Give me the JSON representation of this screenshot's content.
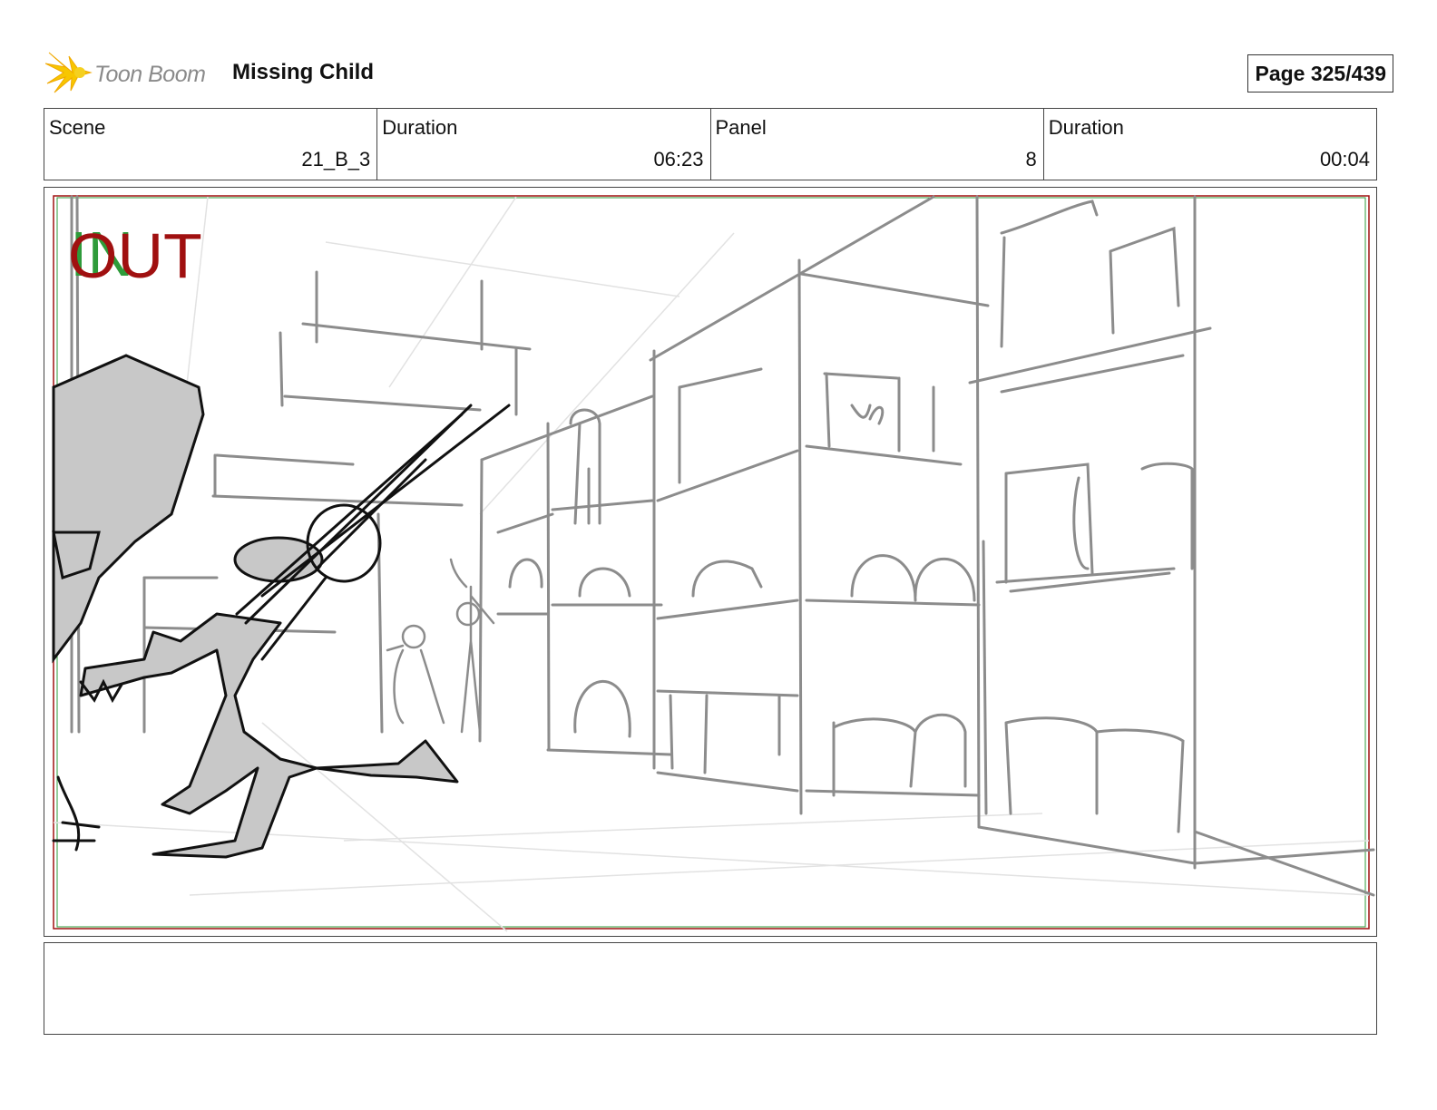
{
  "header": {
    "logo_text": "Toon Boom",
    "project_title": "Missing Child",
    "page_label": "Page 325/439"
  },
  "info": [
    {
      "label": "Scene",
      "value": "21_B_3"
    },
    {
      "label": "Duration",
      "value": "06:23"
    },
    {
      "label": "Panel",
      "value": "8"
    },
    {
      "label": "Duration",
      "value": "00:04"
    }
  ],
  "panel": {
    "in_marker": "IN",
    "out_marker": "OUT",
    "colors": {
      "in": "#2e9b3a",
      "out": "#a01010",
      "sketch": "#8c8c8c",
      "ink": "#111111",
      "fill": "#c8c8c8"
    }
  },
  "notes": {
    "text": ""
  }
}
